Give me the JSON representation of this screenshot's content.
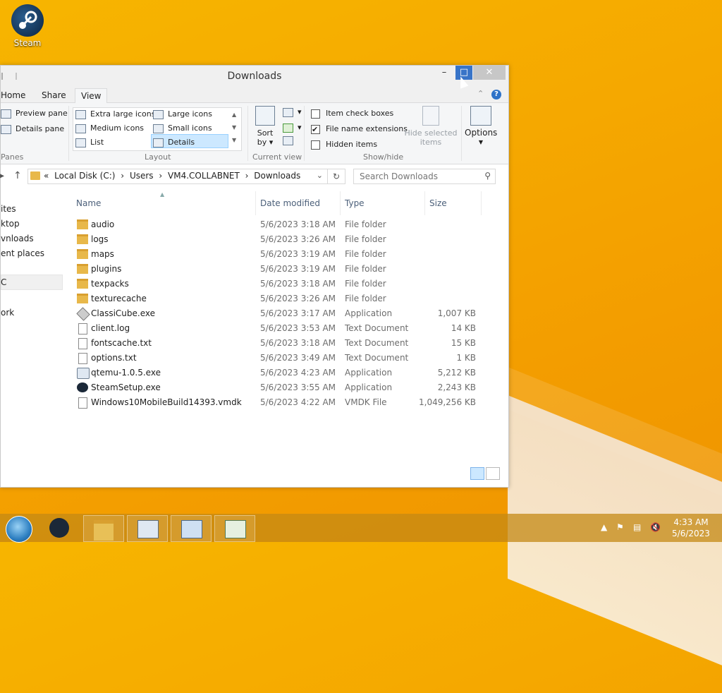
{
  "desktop": {
    "icons": [
      {
        "label": "Steam",
        "icon": "steam-icon"
      }
    ]
  },
  "window": {
    "title": "Downloads",
    "controls": {
      "minimize": "–",
      "maximize": "□",
      "close": "✕"
    }
  },
  "ribbon": {
    "tabs": [
      "Home",
      "Share",
      "View"
    ],
    "active_tab": "View",
    "panes": {
      "preview_pane": "Preview pane",
      "details_pane": "Details pane",
      "label": "Panes"
    },
    "layout": {
      "label": "Layout",
      "items": [
        "Extra large icons",
        "Large icons",
        "Medium icons",
        "Small icons",
        "List",
        "Details"
      ],
      "selected": "Details"
    },
    "current_view": {
      "label": "Current view",
      "sort_by": "Sort",
      "sort_by2": "by"
    },
    "show_hide": {
      "label": "Show/hide",
      "item_check_boxes": "Item check boxes",
      "file_name_extensions": "File name extensions",
      "hidden_items": "Hidden items",
      "item_check_boxes_checked": false,
      "file_name_extensions_checked": true,
      "hidden_items_checked": false,
      "hide_selected": "Hide selected",
      "hide_selected2": "items"
    },
    "options": "Options"
  },
  "address": {
    "crumbs": [
      "«",
      "Local Disk (C:)",
      "›",
      "Users",
      "›",
      "VM4.COLLABNET",
      "›",
      "Downloads"
    ],
    "search_placeholder": "Search Downloads"
  },
  "nav_pane": [
    "ites",
    "ktop",
    "vnloads",
    "ent places",
    "C",
    "ork"
  ],
  "columns": {
    "name": "Name",
    "date": "Date modified",
    "type": "Type",
    "size": "Size"
  },
  "files": [
    {
      "name": "audio",
      "date": "5/6/2023 3:18 AM",
      "type": "File folder",
      "size": "",
      "icon": "folder-icon"
    },
    {
      "name": "logs",
      "date": "5/6/2023 3:26 AM",
      "type": "File folder",
      "size": "",
      "icon": "folder-icon"
    },
    {
      "name": "maps",
      "date": "5/6/2023 3:19 AM",
      "type": "File folder",
      "size": "",
      "icon": "folder-icon"
    },
    {
      "name": "plugins",
      "date": "5/6/2023 3:19 AM",
      "type": "File folder",
      "size": "",
      "icon": "folder-icon"
    },
    {
      "name": "texpacks",
      "date": "5/6/2023 3:18 AM",
      "type": "File folder",
      "size": "",
      "icon": "folder-icon"
    },
    {
      "name": "texturecache",
      "date": "5/6/2023 3:26 AM",
      "type": "File folder",
      "size": "",
      "icon": "folder-icon"
    },
    {
      "name": "ClassiCube.exe",
      "date": "5/6/2023 3:17 AM",
      "type": "Application",
      "size": "1,007 KB",
      "icon": "cube-app-icon"
    },
    {
      "name": "client.log",
      "date": "5/6/2023 3:53 AM",
      "type": "Text Document",
      "size": "14 KB",
      "icon": "document-icon"
    },
    {
      "name": "fontscache.txt",
      "date": "5/6/2023 3:18 AM",
      "type": "Text Document",
      "size": "15 KB",
      "icon": "document-icon"
    },
    {
      "name": "options.txt",
      "date": "5/6/2023 3:49 AM",
      "type": "Text Document",
      "size": "1 KB",
      "icon": "document-icon"
    },
    {
      "name": "qtemu-1.0.5.exe",
      "date": "5/6/2023 4:23 AM",
      "type": "Application",
      "size": "5,212 KB",
      "icon": "app-icon"
    },
    {
      "name": "SteamSetup.exe",
      "date": "5/6/2023 3:55 AM",
      "type": "Application",
      "size": "2,243 KB",
      "icon": "steam-icon"
    },
    {
      "name": "Windows10MobileBuild14393.vmdk",
      "date": "5/6/2023 4:22 AM",
      "type": "VMDK File",
      "size": "1,049,256 KB",
      "icon": "file-icon"
    }
  ],
  "taskbar": {
    "buttons": [
      "start-orb-icon",
      "steam-icon",
      "file-explorer-icon",
      "keyboard-computer-icon",
      "network-computer-icon",
      "control-panel-icon"
    ],
    "tray": {
      "chevron": "▲"
    },
    "clock": {
      "time": "4:33 AM",
      "date": "5/6/2023"
    }
  },
  "colors": {
    "accent": "#3874c8",
    "desktop": "#f5a800",
    "selection": "#cce8ff"
  }
}
